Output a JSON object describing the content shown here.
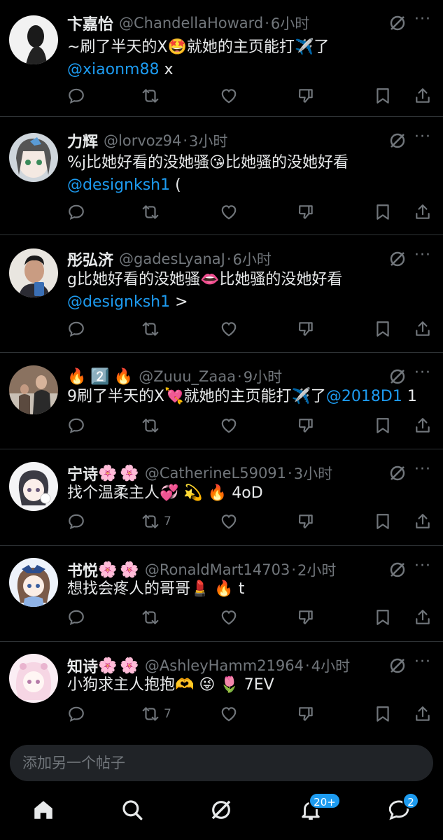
{
  "posts": [
    {
      "name": "卞嘉怡",
      "handle": "@ChandellaHoward",
      "time": "6小时",
      "text_pre": "~刷了半天的X",
      "text_emoji1": "🤩",
      "text_mid": "就她的主页能打",
      "text_emoji2": "✈️",
      "text_post": "了",
      "line2_mention": "@xiaonm88",
      "line2_rest": " x",
      "retweet_count": ""
    },
    {
      "name": "力辉",
      "handle": "@lorvoz94",
      "time": "3小时",
      "text_pre": "%j比她好看的没她骚",
      "text_emoji1": "😘",
      "text_mid": "比她骚的没她好看",
      "line2_mention": "@designksh1",
      "line2_rest": " (",
      "retweet_count": ""
    },
    {
      "name": "彤弘济",
      "handle": "@gadesLyanaJ",
      "time": "6小时",
      "text_pre": "g比她好看的没她骚",
      "text_emoji1": "👄",
      "text_mid": "比她骚的没她好看",
      "line2_mention": "@designksh1",
      "line2_rest": " >",
      "retweet_count": ""
    },
    {
      "name_emojis": [
        "🔥",
        "2️⃣",
        "🔥"
      ],
      "handle": "@Zuuu_Zaaa",
      "time": "9小时",
      "text_pre": "9刷了半天的X",
      "text_emoji1": "💘",
      "text_mid": "就她的主页能打",
      "text_emoji2": "✈️",
      "text_post": "了",
      "inline_mention": "@2018D1",
      "inline_rest": " 1",
      "retweet_count": ""
    },
    {
      "name": "宁诗",
      "name_emojis": [
        "🌸",
        "🌸"
      ],
      "handle": "@CatherineL59091",
      "time": "3小时",
      "text_pre": "找个温柔主人",
      "text_emojis": [
        "💞",
        "💫",
        "🔥"
      ],
      "text_post": "4oD",
      "retweet_count": "7"
    },
    {
      "name": "书悦",
      "name_emojis": [
        "🌸",
        "🌸"
      ],
      "handle": "@RonaldMart14703",
      "time": "2小时",
      "text_pre": "想找会疼人的哥哥",
      "text_emojis": [
        "💄",
        "🔥"
      ],
      "text_post": "t",
      "retweet_count": ""
    },
    {
      "name": "知诗",
      "name_emojis": [
        "🌸",
        "🌸"
      ],
      "handle": "@AshleyHamm21964",
      "time": "4小时",
      "text_pre": "小狗求主人抱抱",
      "text_emojis": [
        "🫶",
        "😜",
        "🌷"
      ],
      "text_post": "7EV",
      "retweet_count": "7"
    }
  ],
  "separator": "·",
  "more_label": "···",
  "composer": {
    "placeholder": "添加另一个帖子"
  },
  "tabbar": {
    "notifications_badge": "20+",
    "messages_badge": "2"
  },
  "colors": {
    "accent": "#1d9bf0",
    "muted": "#71767b",
    "text": "#e7e9ea",
    "bg": "#000000"
  }
}
